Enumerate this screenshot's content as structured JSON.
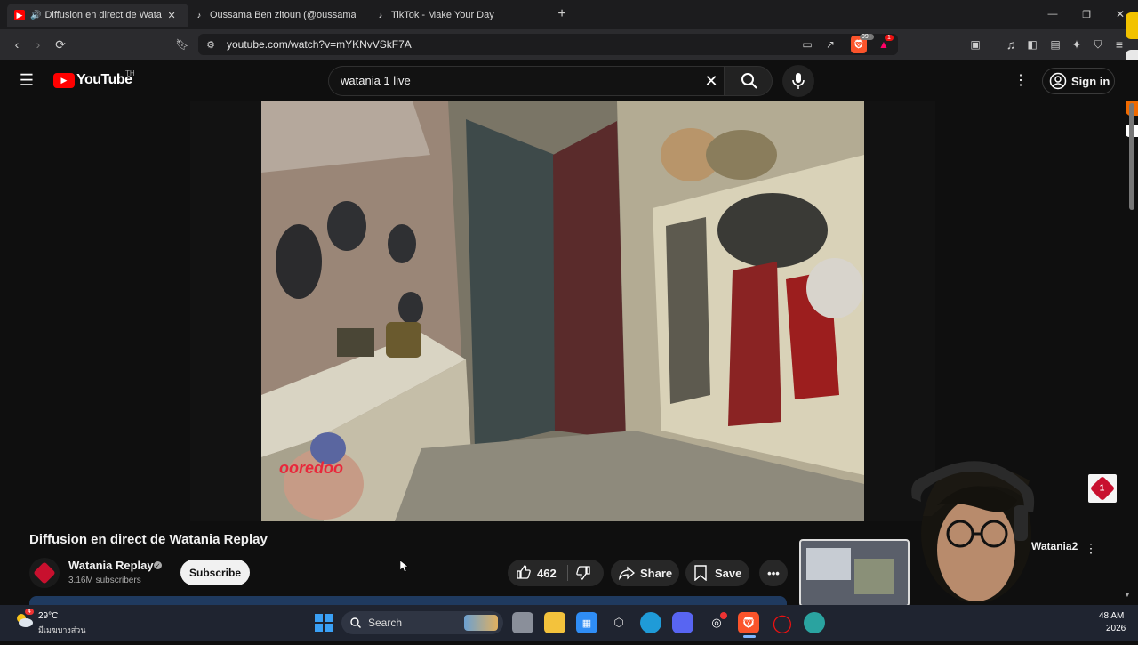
{
  "browser": {
    "tabs": [
      {
        "title": "Diffusion en direct de Watania",
        "active": true
      },
      {
        "title": "Oussama Ben zitoun (@oussama.ben",
        "active": false
      },
      {
        "title": "TikTok - Make Your Day",
        "active": false
      }
    ],
    "new_tab": "+",
    "url": "youtube.com/watch?v=mYKNvVSkF7A",
    "brave_count": "99+",
    "alert_count": "1",
    "window_buttons": {
      "minimize": "—",
      "restore": "❐",
      "close": "✕"
    }
  },
  "youtube": {
    "logo_text": "YouTube",
    "region": "TH",
    "search_value": "watania 1 live",
    "signin_label": "Sign in"
  },
  "video": {
    "watermark": "ooredoo",
    "corner_logo": "1"
  },
  "meta": {
    "title": "Diffusion en direct de Watania Replay",
    "channel_name": "Watania Replay",
    "subscribers": "3.16M subscribers",
    "subscribe_label": "Subscribe",
    "likes": "462",
    "share_label": "Share",
    "save_label": "Save"
  },
  "sidebar": {
    "recommended_channel": "Watania2"
  },
  "taskbar": {
    "temperature": "29°C",
    "weather_text": "มีเมฆบางส่วน",
    "weather_badge": "4",
    "search_label": "Search",
    "time_partial": "48 AM",
    "date_partial": "2026"
  },
  "colors": {
    "yt_red": "#ff0000",
    "chrome_bg": "#2b2b2e",
    "page_bg": "#0f0f0f",
    "brave_orange": "#fb542b"
  }
}
